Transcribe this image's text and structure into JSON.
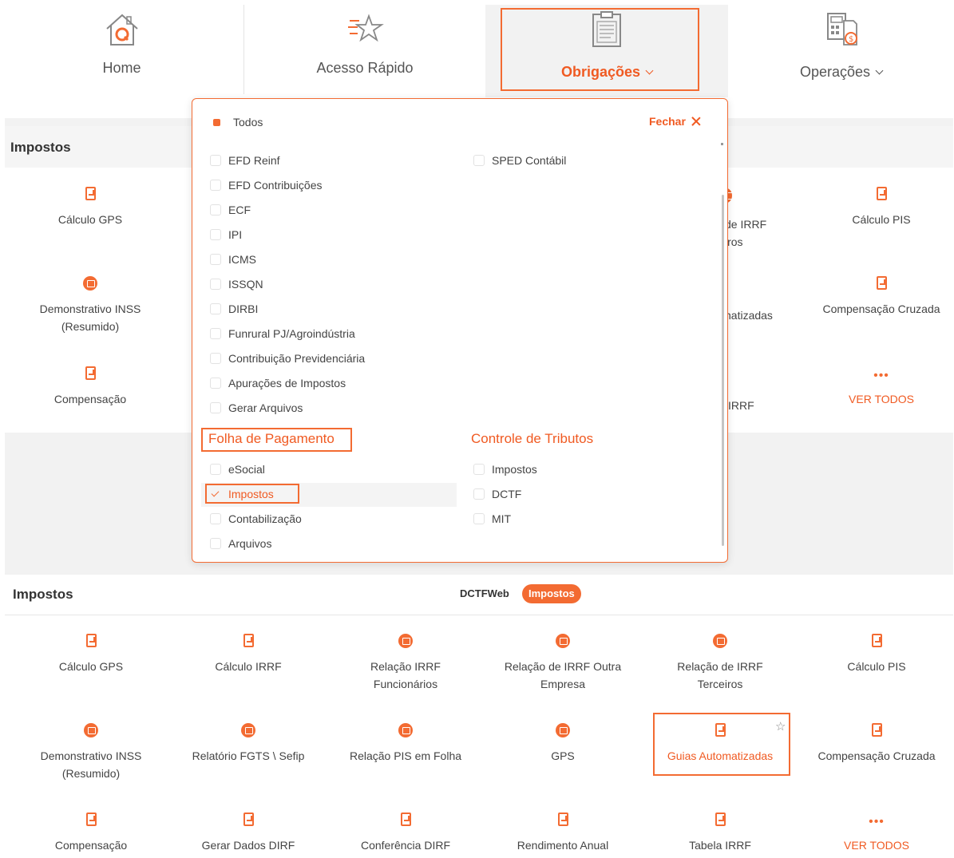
{
  "nav": {
    "home": "Home",
    "acesso_rapido": "Acesso Rápido",
    "obrigacoes": "Obrigações",
    "operacoes": "Operações"
  },
  "bg_section": {
    "title": "Impostos",
    "tiles": {
      "calculo_gps": "Cálculo GPS",
      "irrf_terceiros_partial_1": "de IRRF",
      "irrf_terceiros_partial_2": "iros",
      "calculo_pis": "Cálculo PIS",
      "demonstrativo_inss_1": "Demonstrativo INSS",
      "demonstrativo_inss_2": "(Resumido)",
      "guias_partial": "natizadas",
      "compensacao_cruzada": "Compensação Cruzada",
      "compensacao": "Compensação",
      "irrf_partial": "IRRF",
      "ver_todos": "VER TODOS"
    }
  },
  "dropdown": {
    "todos": "Todos",
    "fechar": "Fechar",
    "left_items": [
      "EFD Reinf",
      "EFD Contribuições",
      "ECF",
      "IPI",
      "ICMS",
      "ISSQN",
      "DIRBI",
      "Funrural PJ/Agroindústria",
      "Contribuição Previdenciária",
      "Apurações de Impostos",
      "Gerar Arquivos"
    ],
    "right_items": [
      "SPED Contábil"
    ],
    "folha_title": "Folha de Pagamento",
    "folha_items": [
      "eSocial",
      "Impostos",
      "Contabilização",
      "Arquivos"
    ],
    "controle_title": "Controle de Tributos",
    "controle_items": [
      "Impostos",
      "DCTF",
      "MIT"
    ]
  },
  "main_section": {
    "title": "Impostos",
    "pill_dctfweb": "DCTFWeb",
    "pill_impostos": "Impostos",
    "row1": [
      "Cálculo GPS",
      "Cálculo IRRF",
      "Relação IRRF",
      "Relação de IRRF Outra",
      "Relação de IRRF",
      "Cálculo PIS"
    ],
    "row1_line2": [
      "",
      "",
      "Funcionários",
      "Empresa",
      "Terceiros",
      ""
    ],
    "row2": [
      "Demonstrativo INSS",
      "Relatório FGTS \\ Sefip",
      "Relação PIS em Folha",
      "GPS",
      "Guias Automatizadas",
      "Compensação Cruzada"
    ],
    "row2_line2": [
      "(Resumido)",
      "",
      "",
      "",
      "",
      ""
    ],
    "row3": [
      "Compensação",
      "Gerar Dados DIRF",
      "Conferência DIRF",
      "Rendimento Anual",
      "Tabela IRRF",
      "VER TODOS"
    ]
  },
  "colors": {
    "accent": "#f36b32",
    "accent_text": "#f05a22"
  }
}
